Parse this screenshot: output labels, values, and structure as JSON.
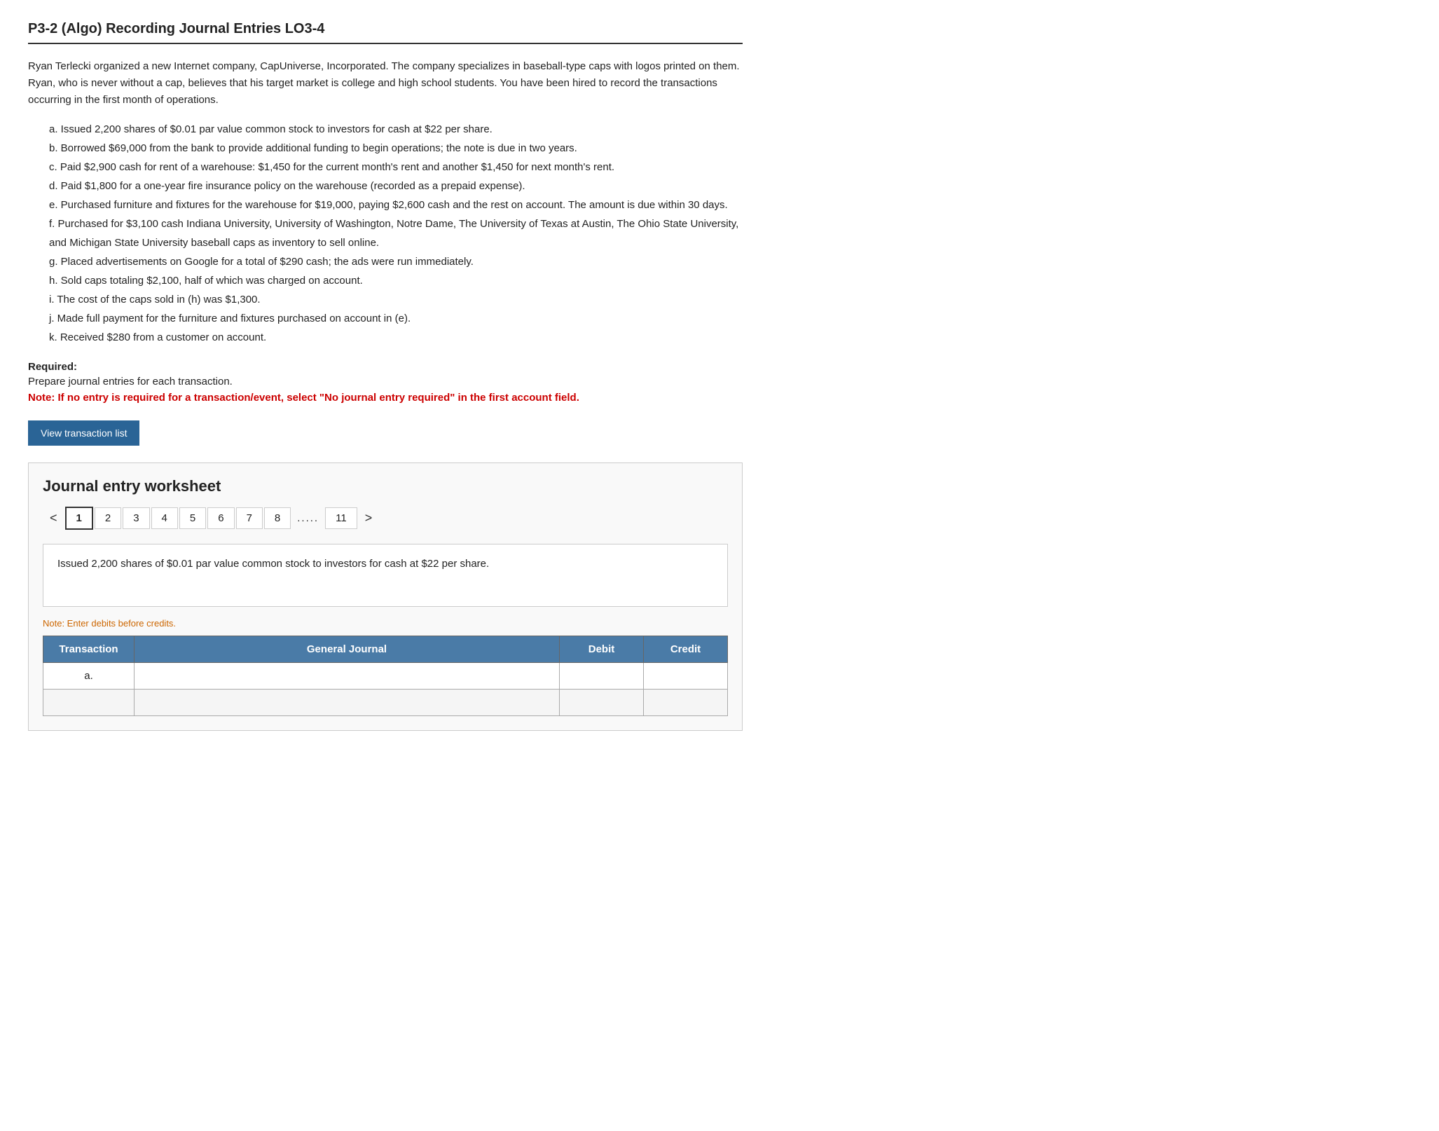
{
  "header": {
    "title": "P3-2 (Algo) Recording Journal Entries LO3-4"
  },
  "intro": {
    "paragraph": "Ryan Terlecki organized a new Internet company, CapUniverse, Incorporated. The company specializes in baseball-type caps with logos printed on them. Ryan, who is never without a cap, believes that his target market is college and high school students. You have been hired to record the transactions occurring in the first month of operations."
  },
  "transactions": [
    "a. Issued 2,200 shares of $0.01 par value common stock to investors for cash at $22 per share.",
    "b. Borrowed $69,000 from the bank to provide additional funding to begin operations; the note is due in two years.",
    "c. Paid $2,900 cash for rent of a warehouse: $1,450 for the current month's rent and another $1,450 for next month's rent.",
    "d. Paid $1,800 for a one-year fire insurance policy on the warehouse (recorded as a prepaid expense).",
    "e. Purchased furniture and fixtures for the warehouse for $19,000, paying $2,600 cash and the rest on account. The amount is due within 30 days.",
    "f. Purchased for $3,100 cash Indiana University, University of Washington, Notre Dame, The University of Texas at Austin, The Ohio State University, and Michigan State University baseball caps as inventory to sell online.",
    "g. Placed advertisements on Google for a total of $290 cash; the ads were run immediately.",
    "h. Sold caps totaling $2,100, half of which was charged on account.",
    "i. The cost of the caps sold in (h) was $1,300.",
    "j. Made full payment for the furniture and fixtures purchased on account in (e).",
    "k. Received $280 from a customer on account."
  ],
  "required": {
    "label": "Required:",
    "instruction": "Prepare journal entries for each transaction.",
    "note": "Note: If no entry is required for a transaction/event, select \"No journal entry required\" in the first account field."
  },
  "view_btn": {
    "label": "View transaction list"
  },
  "worksheet": {
    "title": "Journal entry worksheet",
    "pagination": {
      "prev": "<",
      "next": ">",
      "pages": [
        "1",
        "2",
        "3",
        "4",
        "5",
        "6",
        "7",
        "8",
        ".....",
        "11"
      ],
      "active": "1"
    },
    "description": "Issued 2,200 shares of $0.01 par value common stock to investors for cash at $22 per share.",
    "note": "Note: Enter debits before credits.",
    "table": {
      "headers": {
        "transaction": "Transaction",
        "general_journal": "General Journal",
        "debit": "Debit",
        "credit": "Credit"
      },
      "rows": [
        {
          "transaction": "a.",
          "general_journal": "",
          "debit": "",
          "credit": ""
        },
        {
          "transaction": "",
          "general_journal": "",
          "debit": "",
          "credit": ""
        }
      ]
    }
  }
}
